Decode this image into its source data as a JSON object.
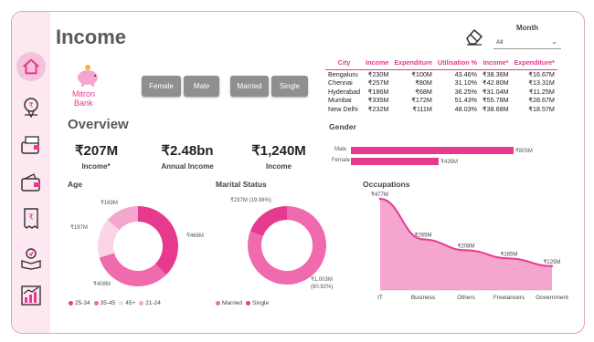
{
  "page": {
    "title": "Income"
  },
  "filters": {
    "month_label": "Month",
    "month_value": "All"
  },
  "brand": {
    "name_line1": "Mitron",
    "name_line2": "Bank"
  },
  "buttons": {
    "female": "Female",
    "male": "Male",
    "married": "Married",
    "single": "Single"
  },
  "city_table": {
    "headers": [
      "City",
      "Income",
      "Expenditure",
      "Utilisation %",
      "Income*",
      "Expenditure*"
    ],
    "rows": [
      [
        "Bengaluru",
        "₹230M",
        "₹100M",
        "43.46%",
        "₹38.36M",
        "₹16.67M"
      ],
      [
        "Chennai",
        "₹257M",
        "₹80M",
        "31.10%",
        "₹42.80M",
        "₹13.31M"
      ],
      [
        "Hyderabad",
        "₹186M",
        "₹68M",
        "36.25%",
        "₹31.04M",
        "₹11.25M"
      ],
      [
        "Mumbai",
        "₹335M",
        "₹172M",
        "51.43%",
        "₹55.78M",
        "₹28.67M"
      ],
      [
        "New Delhi",
        "₹232M",
        "₹111M",
        "48.03%",
        "₹38.68M",
        "₹18.57M"
      ]
    ]
  },
  "overview": {
    "title": "Overview",
    "kpis": [
      {
        "value": "₹207M",
        "label": "Income*"
      },
      {
        "value": "₹2.48bn",
        "label": "Annual Income"
      },
      {
        "value": "₹1,240M",
        "label": "Income"
      }
    ]
  },
  "gender": {
    "title": "Gender",
    "bars": [
      {
        "label": "Male",
        "value_label": "₹805M",
        "value": 805
      },
      {
        "label": "Female",
        "value_label": "₹435M",
        "value": 435
      }
    ]
  },
  "age": {
    "title": "Age",
    "labels": [
      "₹169M",
      "₹466M",
      "₹408M",
      "₹197M"
    ],
    "legend": [
      "25-34",
      "35-45",
      "45+",
      "21-24"
    ],
    "values": [
      466,
      408,
      197,
      169
    ]
  },
  "marital": {
    "title": "Marital Status",
    "label_single": "₹237M (19.08%)",
    "label_married_1": "₹1,003M",
    "label_married_2": "(80.92%)",
    "legend": [
      "Married",
      "Single"
    ],
    "values": [
      1003,
      237
    ]
  },
  "occupations": {
    "title": "Occupations",
    "categories": [
      "IT",
      "Business",
      "Others",
      "Freelancers",
      "Government"
    ],
    "value_labels": [
      "₹477M",
      "₹265M",
      "₹208M",
      "₹165M",
      "₹125M"
    ],
    "values": [
      477,
      265,
      208,
      165,
      125
    ]
  },
  "colors": {
    "accent": "#e73a8e",
    "light_pink": "#f4a6cf",
    "pale_pink": "#fbd5e7",
    "button_gray": "#8f8f8f"
  },
  "nav_icons": [
    "home-icon",
    "money-location-icon",
    "wallet-cash-icon",
    "wallet-icon",
    "bill-receipt-icon",
    "book-badge-icon",
    "growth-chart-icon"
  ]
}
